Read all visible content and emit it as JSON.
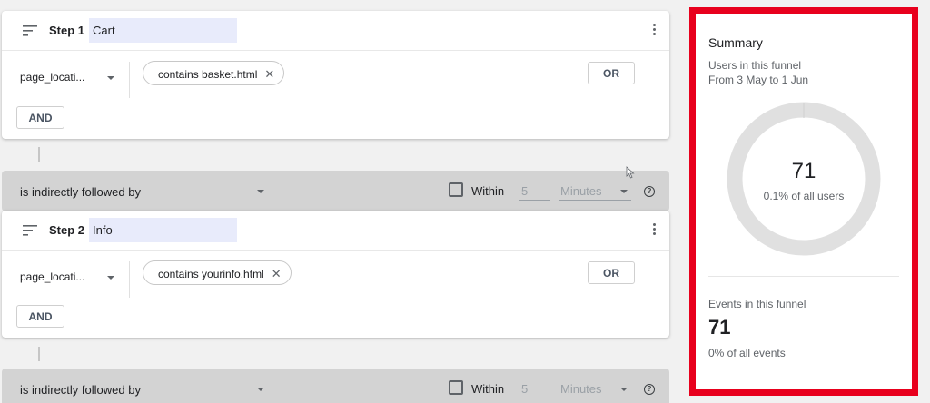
{
  "steps": [
    {
      "label": "Step 1",
      "name": "Cart",
      "dimension": "page_locati...",
      "condition": "contains basket.html",
      "or_label": "OR",
      "and_label": "AND"
    },
    {
      "label": "Step 2",
      "name": "Info",
      "dimension": "page_locati...",
      "condition": "contains yourinfo.html",
      "or_label": "OR",
      "and_label": "AND"
    }
  ],
  "followed_bars": [
    {
      "relation": "is indirectly followed by",
      "within_label": "Within",
      "within_value": "5",
      "unit": "Minutes",
      "help": "?"
    },
    {
      "relation": "is indirectly followed by",
      "within_label": "Within",
      "within_value": "5",
      "unit": "Minutes",
      "help": "?"
    }
  ],
  "summary": {
    "title": "Summary",
    "users_label": "Users in this funnel",
    "date_range": "From 3 May to 1 Jun",
    "users_value": "71",
    "users_share": "0.1% of all users",
    "events_label": "Events in this funnel",
    "events_value": "71",
    "events_share": "0% of all events",
    "highlight_color": "#e8001d",
    "ring_color": "#e0e0e0"
  },
  "icons": {
    "sort": "sort-icon",
    "more": "more-vert-icon",
    "remove": "close-icon",
    "help": "help-icon",
    "dropdown": "caret-down-icon"
  }
}
